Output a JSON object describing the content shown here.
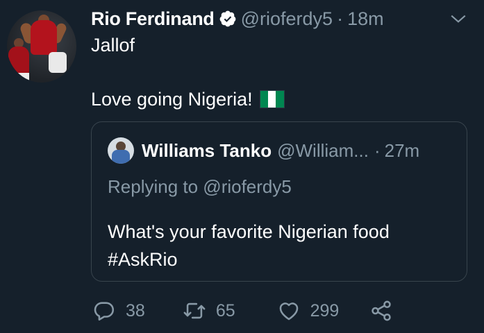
{
  "tweet": {
    "author_name": "Rio Ferdinand",
    "handle": "@rioferdy5",
    "separator": "·",
    "time": "18m",
    "text_line1": "Jallof",
    "text_line2": "Love going Nigeria!",
    "flag_emoji": "nigeria-flag",
    "avatar": "avatar-rio-ferdinand"
  },
  "quoted": {
    "author_name": "Williams Tanko",
    "handle": "@William...",
    "separator": "·",
    "time": "27m",
    "replying": "Replying to @rioferdy5",
    "text_line1": "What's your favorite Nigerian food",
    "text_line2": "#AskRio"
  },
  "actions": {
    "replies": "38",
    "retweets": "65",
    "likes": "299"
  },
  "colors": {
    "background": "#15202b",
    "text": "#ffffff",
    "muted": "#8899a6",
    "border": "#38444d",
    "flag_green": "#008751"
  }
}
